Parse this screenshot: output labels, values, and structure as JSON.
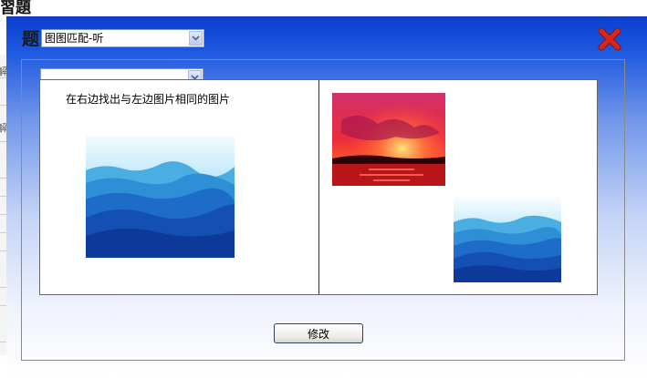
{
  "background": {
    "title_fragment": "習題",
    "side_chars": [
      "解",
      "解"
    ]
  },
  "dialog": {
    "title": "题",
    "type_select": {
      "value": "图图匹配-听"
    },
    "sub_select": {
      "value": ""
    },
    "close_icon": "close-x-icon",
    "instruction": "在右边找出与左边图片相同的图片",
    "left_image": "blue-mountains-image",
    "right_images": [
      "red-sunset-image",
      "blue-mountains-image"
    ],
    "save_label": "修改",
    "colors": {
      "header_top": "#0b3fd0",
      "close_red": "#c8221a",
      "border": "#7f9db9"
    }
  }
}
